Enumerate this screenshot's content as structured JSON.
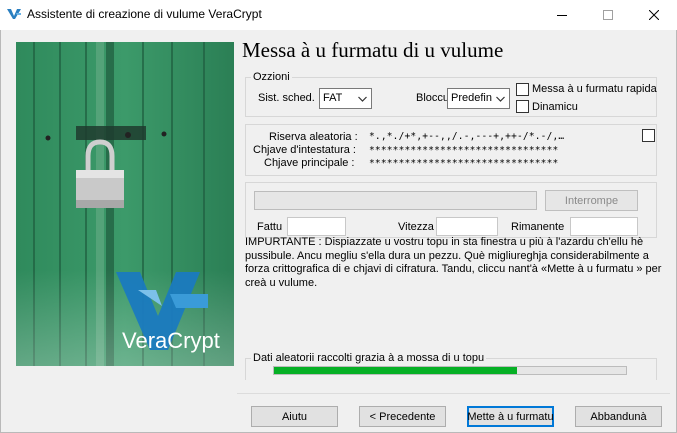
{
  "window": {
    "title": "Assistente di creazione di vulume VeraCrypt",
    "controls": {
      "minimize": "—",
      "maximize": "☐",
      "close": "✕"
    }
  },
  "branding": {
    "logo_text": "VeraCrypt"
  },
  "page": {
    "title": "Messa à u furmatu di u vulume"
  },
  "options": {
    "legend": "Ozzioni",
    "filesystem_label": "Sist. sched.",
    "filesystem_value": "FAT",
    "cluster_label": "Bloccu",
    "cluster_value": "Predefin",
    "quick_format_label": "Messa à u furmatu rapida",
    "quick_format_checked": false,
    "dynamic_label": "Dinamicu",
    "dynamic_checked": false
  },
  "random": {
    "pool_label": "Riserva aleatoria :",
    "pool_value": "*.,*./+*,+--,,/.-,---+,++-/*.-/,…",
    "header_key_label": "Chjave d'intestatura :",
    "header_key_value": "********************************",
    "master_key_label": "Chjave principale :",
    "master_key_value": "********************************",
    "show_checked": false
  },
  "progress": {
    "abort_label": "Interrompe",
    "done_label": "Fattu",
    "done_value": "",
    "speed_label": "Vitezza",
    "speed_value": "",
    "left_label": "Rimanente",
    "left_value": "",
    "percent": 0
  },
  "warning_text": "IMPURTANTE : Dispiazzate u vostru topu in sta finestra u più à l'azardu ch'ellu hè pussibule. Ancu megliu s'ella dura un pezzu. Què migliureghja considerabilmente a forza crittografica di e chjavi di cifratura. Tandu, cliccu nant'à «Mette à u furmatu » per creà u vulume.",
  "entropy": {
    "legend": "Dati aleatorii raccolti grazia à a mossa di u topu",
    "fill_fraction": 0.69,
    "color": "#06b025"
  },
  "buttons": {
    "help": "Aiutu",
    "prev": "< Precedente",
    "format": "Mette à u furmatu",
    "cancel": "Abbandunà"
  }
}
